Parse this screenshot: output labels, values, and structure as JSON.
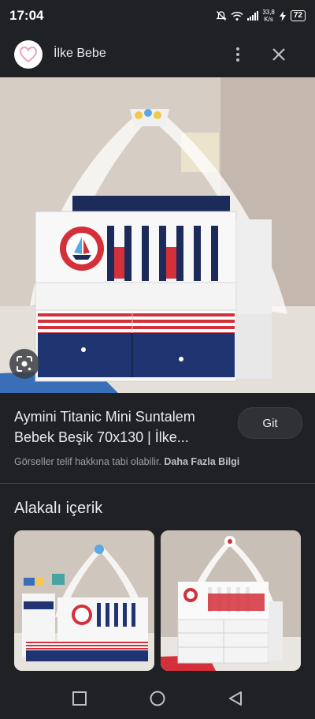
{
  "status_bar": {
    "time": "17:04",
    "speed_value": "33,8",
    "speed_unit": "K/s",
    "battery": "72"
  },
  "header": {
    "site_name": "İlke Bebe"
  },
  "result": {
    "title": "Aymini Titanic Mini Suntalem Bebek Beşik 70x130 | İlke...",
    "visit_label": "Git",
    "copyright_text": "Görseller telif hakkına tabi olabilir.",
    "more_info_label": "Daha Fazla Bilgi"
  },
  "related": {
    "heading": "Alakalı içerik"
  },
  "colors": {
    "background": "#202124",
    "text": "#e8eaed",
    "muted": "#9aa0a6",
    "crib_red": "#d4303a",
    "crib_navy": "#1f3470"
  }
}
